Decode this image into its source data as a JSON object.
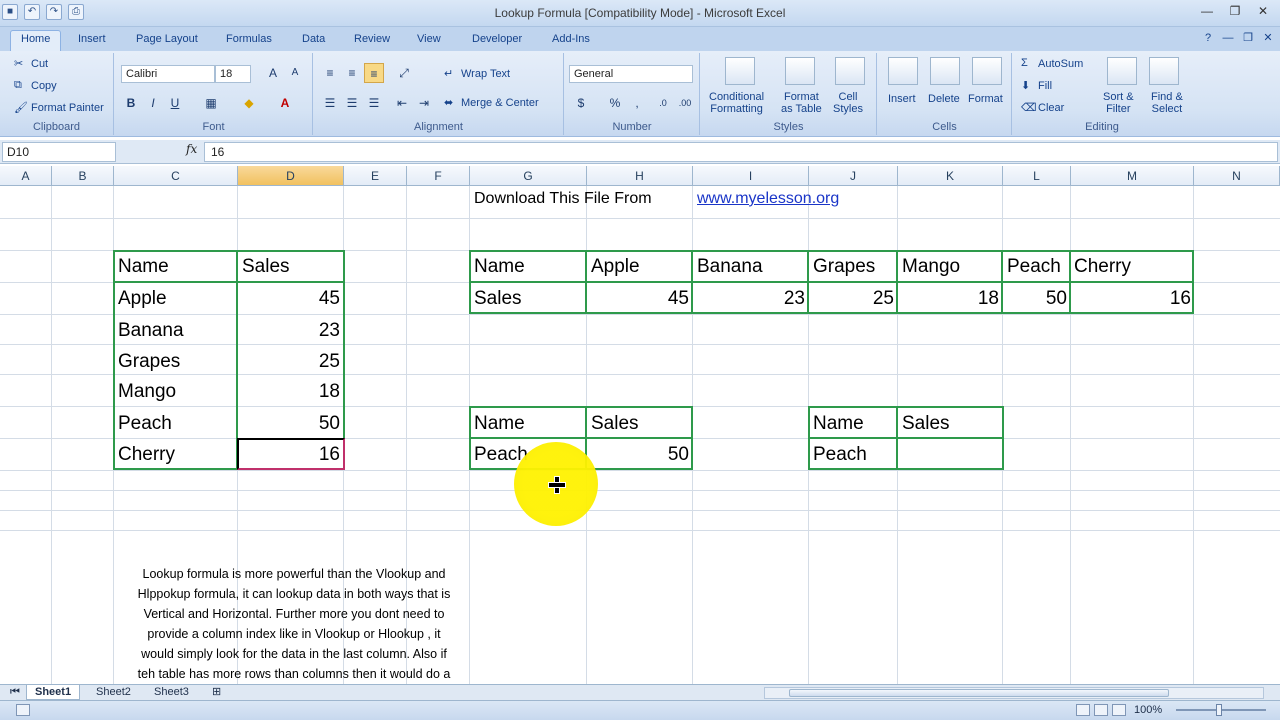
{
  "window": {
    "title": "Lookup Formula  [Compatibility Mode] - Microsoft Excel"
  },
  "ribbon_tabs": [
    "Home",
    "Insert",
    "Page Layout",
    "Formulas",
    "Data",
    "Review",
    "View",
    "Developer",
    "Add-Ins"
  ],
  "clipboard": {
    "cut": "Cut",
    "copy": "Copy",
    "format_painter": "Format Painter",
    "label": "Clipboard"
  },
  "font": {
    "family": "Calibri",
    "size": "18",
    "label": "Font"
  },
  "alignment": {
    "wrap_text": "Wrap Text",
    "merge_center": "Merge & Center",
    "label": "Alignment"
  },
  "number": {
    "format": "General",
    "label": "Number"
  },
  "styles": {
    "conditional_1": "Conditional",
    "conditional_2": "Formatting",
    "format_table_1": "Format",
    "format_table_2": "as Table",
    "cell_styles_1": "Cell",
    "cell_styles_2": "Styles",
    "label": "Styles"
  },
  "cells": {
    "insert": "Insert",
    "delete": "Delete",
    "format": "Format",
    "label": "Cells"
  },
  "editing": {
    "autosum": "AutoSum",
    "fill": "Fill",
    "clear": "Clear",
    "sort_1": "Sort &",
    "sort_2": "Filter",
    "find_1": "Find &",
    "find_2": "Select",
    "label": "Editing"
  },
  "formula_bar": {
    "name_box": "D10",
    "fx": "fx",
    "value": "16"
  },
  "columns": [
    "A",
    "B",
    "C",
    "D",
    "E",
    "F",
    "G",
    "H",
    "I",
    "J",
    "K",
    "L",
    "M",
    "N"
  ],
  "sheet": {
    "download_text": "Download This File From",
    "download_link": "www.myelesson.org",
    "vertical_table": {
      "headers": [
        "Name",
        "Sales"
      ],
      "rows": [
        [
          "Apple",
          "45"
        ],
        [
          "Banana",
          "23"
        ],
        [
          "Grapes",
          "25"
        ],
        [
          "Mango",
          "18"
        ],
        [
          "Peach",
          "50"
        ],
        [
          "Cherry",
          "16"
        ]
      ]
    },
    "horizontal_table": {
      "row1": [
        "Name",
        "Apple",
        "Banana",
        "Grapes",
        "Mango",
        "Peach",
        "Cherry"
      ],
      "row2": [
        "Sales",
        "45",
        "23",
        "25",
        "18",
        "50",
        "16"
      ]
    },
    "lookup_table_1": {
      "headers": [
        "Name",
        "Sales"
      ],
      "name": "Peach",
      "sales": "50"
    },
    "lookup_table_2": {
      "headers": [
        "Name",
        "Sales"
      ],
      "name": "Peach",
      "sales": ""
    },
    "note_lines": [
      "Lookup formula is more powerful than the Vlookup and",
      "Hlppokup formula, it can lookup data in both ways that is",
      "Vertical and Horizontal. Further more you dont need to",
      "provide a column index like in Vlookup or Hlookup , it",
      "would simply look for the data in the last column. Also if",
      "teh table has more rows than columns then it would do a"
    ]
  },
  "sheet_tabs": [
    "Sheet1",
    "Sheet2",
    "Sheet3"
  ],
  "status": {
    "zoom": "100%"
  }
}
